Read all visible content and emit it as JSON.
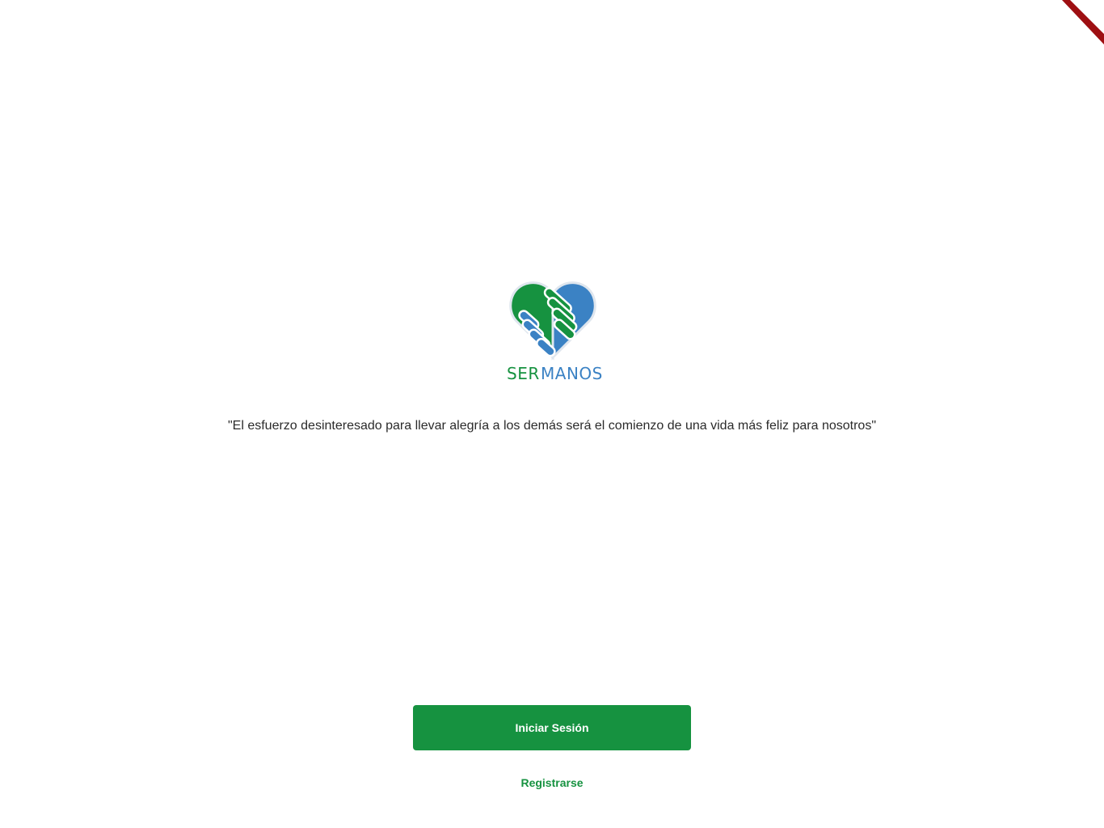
{
  "app": {
    "logo": {
      "icon": "heart-handshake-icon",
      "name_part_1": "SER",
      "name_part_2": "MANOS"
    },
    "quote": "\"El esfuerzo desinteresado para llevar alegría a los demás será el comienzo de una vida más feliz para nosotros\"",
    "login_button_label": "Iniciar Sesión",
    "register_link_label": "Registrarse"
  },
  "colors": {
    "primary_green": "#169240",
    "brand_blue": "#3b82c4",
    "text": "#2b2b2b",
    "debug_banner": "#b40000"
  }
}
